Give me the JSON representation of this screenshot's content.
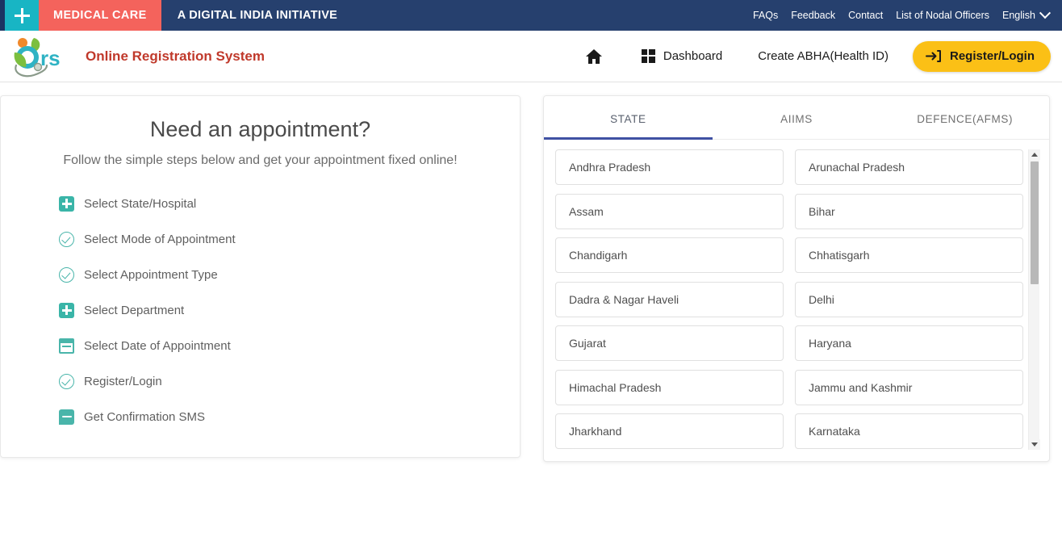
{
  "topbar": {
    "plus_icon": "plus-icon",
    "medical_care": "MEDICAL CARE",
    "initiative": "A DIGITAL INDIA INITIATIVE",
    "links": [
      {
        "label": "FAQs"
      },
      {
        "label": "Feedback"
      },
      {
        "label": "Contact"
      },
      {
        "label": "List of Nodal Officers"
      }
    ],
    "language": "English",
    "chevron_icon": "chevron-down-icon",
    "bg_color": "#26406e",
    "accent_color": "#f4635c",
    "plus_bg_color": "#18b5c4"
  },
  "header": {
    "logo_alt": "ors-logo",
    "brand": "Online Registration System",
    "brand_color": "#c0392b",
    "nav": [
      {
        "label": "",
        "icon": "home-icon",
        "name": "home"
      },
      {
        "label": "Dashboard",
        "icon": "dashboard-icon",
        "name": "dashboard"
      },
      {
        "label": "Create ABHA(Health ID)",
        "icon": "",
        "name": "create-abha"
      }
    ],
    "register_button": {
      "label": "Register/Login",
      "icon": "login-arrow-icon",
      "bg_color": "#fbc016"
    }
  },
  "left_panel": {
    "title": "Need an appointment?",
    "subtitle": "Follow the simple steps below and get your appointment fixed online!",
    "steps": [
      {
        "label": "Select State/Hospital",
        "icon": "plus-square-icon"
      },
      {
        "label": "Select Mode of Appointment",
        "icon": "check-circle-icon"
      },
      {
        "label": "Select Appointment Type",
        "icon": "check-circle-icon"
      },
      {
        "label": "Select Department",
        "icon": "plus-square-icon"
      },
      {
        "label": "Select Date of Appointment",
        "icon": "calendar-icon"
      },
      {
        "label": "Register/Login",
        "icon": "check-circle-icon"
      },
      {
        "label": "Get Confirmation SMS",
        "icon": "sms-bubble-icon"
      }
    ],
    "icon_color": "#3ab5a8"
  },
  "right_panel": {
    "tabs": [
      {
        "label": "STATE",
        "active": true
      },
      {
        "label": "AIIMS",
        "active": false
      },
      {
        "label": "DEFENCE(AFMS)",
        "active": false
      }
    ],
    "active_tab_color": "#3f51a3",
    "states": [
      "Andhra Pradesh",
      "Arunachal Pradesh",
      "Assam",
      "Bihar",
      "Chandigarh",
      "Chhatisgarh",
      "Dadra & Nagar Haveli",
      "Delhi",
      "Gujarat",
      "Haryana",
      "Himachal Pradesh",
      "Jammu and Kashmir",
      "Jharkhand",
      "Karnataka"
    ],
    "scrollbar": {
      "up_icon": "scroll-up-arrow-icon",
      "down_icon": "scroll-down-arrow-icon",
      "thumb_position": "top"
    }
  }
}
